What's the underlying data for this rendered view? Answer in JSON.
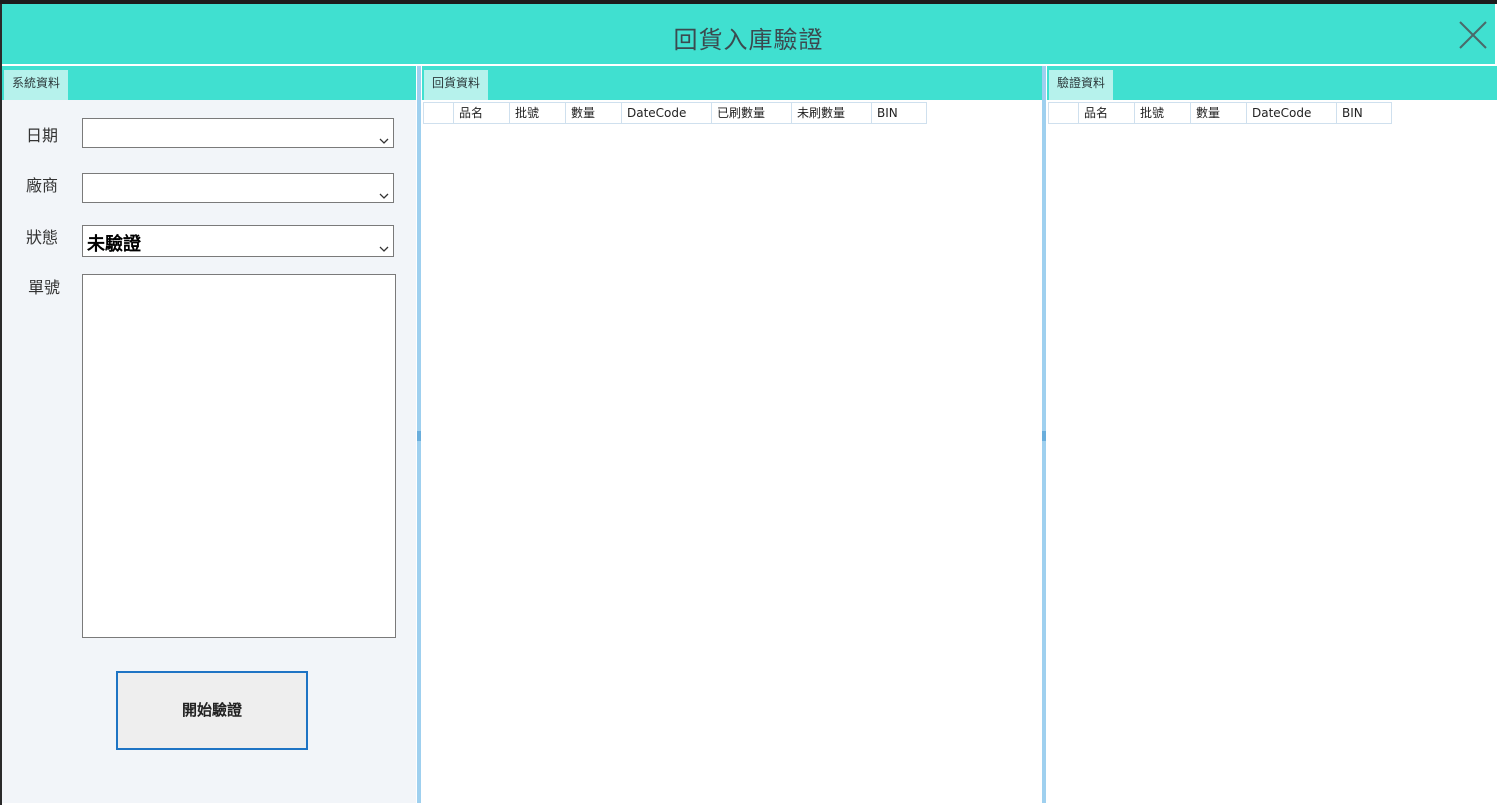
{
  "window": {
    "title": "回貨入庫驗證",
    "accent_color": "#40e0d0",
    "close_icon": "close-icon"
  },
  "system_panel": {
    "tab_label": "系統資料",
    "date_label": "日期",
    "date_value": "",
    "vendor_label": "廠商",
    "vendor_value": "",
    "status_label": "狀態",
    "status_value": "未驗證",
    "order_label": "單號",
    "order_value": "",
    "start_button": "開始驗證"
  },
  "return_panel": {
    "tab_label": "回貨資料",
    "columns": [
      "品名",
      "批號",
      "數量",
      "DateCode",
      "已刷數量",
      "未刷數量",
      "BIN"
    ],
    "rows": []
  },
  "verify_panel": {
    "tab_label": "驗證資料",
    "columns": [
      "品名",
      "批號",
      "數量",
      "DateCode",
      "BIN"
    ],
    "rows": []
  }
}
